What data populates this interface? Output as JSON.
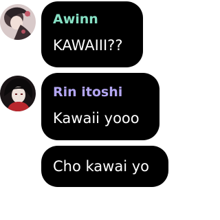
{
  "messages": [
    {
      "sender": "Awinn",
      "sender_color": "#86e0c4",
      "text": "KAWAIII??",
      "avatar_icon": "user-avatar-icon"
    },
    {
      "sender": "Rin itoshi",
      "sender_color": "#b3a6f2",
      "text": "Kawaii yooo",
      "avatar_icon": "user-avatar-icon"
    },
    {
      "text": "Cho kawai yo"
    }
  ],
  "colors": {
    "bubble_background": "#000000",
    "message_text": "#ffffff",
    "page_background": "#ffffff"
  }
}
